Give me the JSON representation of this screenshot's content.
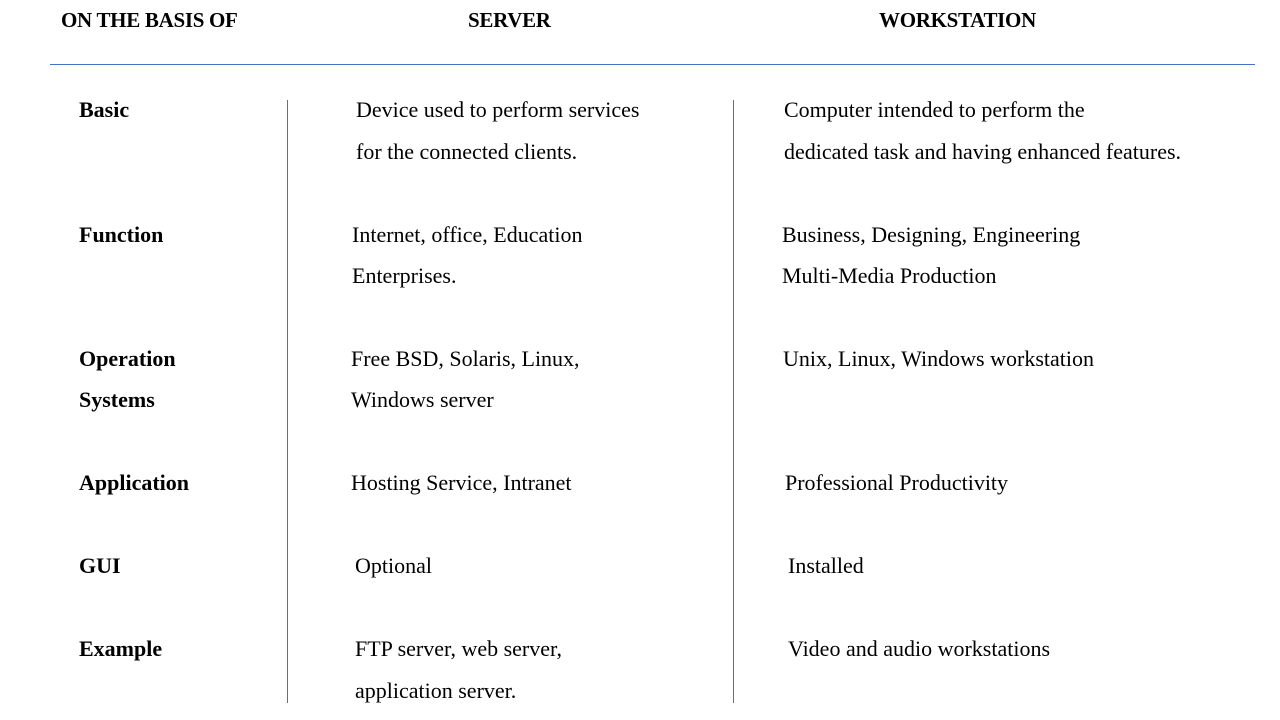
{
  "colors": {
    "rule": "#4472C4",
    "text": "#000000",
    "background": "#FFFFFF"
  },
  "header": {
    "basis": "ON THE BASIS OF",
    "server": "SERVER",
    "workstation": "WORKSTATION"
  },
  "rows": [
    {
      "label": [
        "Basic"
      ],
      "server": [
        "Device used to perform services",
        "for the connected clients."
      ],
      "workstation": [
        "Computer intended to perform the",
        "dedicated task and having  enhanced features."
      ]
    },
    {
      "label": [
        "Function"
      ],
      "server": [
        "Internet, office, Education",
        "Enterprises."
      ],
      "workstation": [
        "Business, Designing, Engineering",
        "Multi-Media Production"
      ]
    },
    {
      "label": [
        "Operation",
        "Systems"
      ],
      "server": [
        "Free BSD, Solaris, Linux,",
        "Windows server"
      ],
      "workstation": [
        "Unix, Linux, Windows workstation"
      ]
    },
    {
      "label": [
        "Application"
      ],
      "server": [
        "Hosting Service, Intranet"
      ],
      "workstation": [
        "Professional Productivity"
      ]
    },
    {
      "label": [
        "GUI"
      ],
      "server": [
        "Optional"
      ],
      "workstation": [
        "Installed"
      ]
    },
    {
      "label": [
        "Example"
      ],
      "server": [
        "FTP server, web server,",
        "application server."
      ],
      "workstation": [
        "Video and audio workstations"
      ]
    }
  ]
}
